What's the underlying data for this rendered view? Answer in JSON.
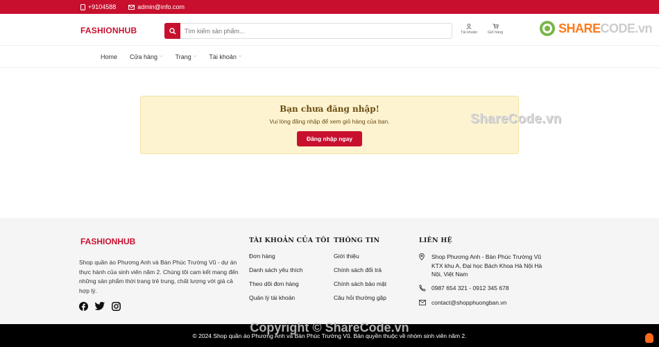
{
  "topbar": {
    "phone": "+9104588",
    "email": "admin@info.com"
  },
  "header": {
    "logo": "FASHIONHUB",
    "search_placeholder": "Tìm kiếm sản phẩm...",
    "account_label": "Tài khoản",
    "cart_label": "Giỏ hàng"
  },
  "watermark_logo": {
    "text_a": "SHARE",
    "text_b": "CODE.vn"
  },
  "nav": [
    {
      "label": "Home",
      "has_dropdown": false
    },
    {
      "label": "Cửa hàng",
      "has_dropdown": true
    },
    {
      "label": "Trang",
      "has_dropdown": true
    },
    {
      "label": "Tài khoản",
      "has_dropdown": true
    }
  ],
  "alert": {
    "title": "Bạn chưa đăng nhập!",
    "message": "Vui lòng đăng nhập để xem giỏ hàng của bạn.",
    "button": "Đăng nhập ngay"
  },
  "watermark_mid": "ShareCode.vn",
  "footer": {
    "logo": "FASHIONHUB",
    "description": "Shop quần áo Phương Anh và Bàn Phúc Trường Vũ - dự án thực hành của sinh viên năm 2. Chúng tôi cam kết mang đến những sản phẩm thời trang trẻ trung, chất lượng với giá cả hợp lý.",
    "social_icons": [
      "facebook-icon",
      "twitter-icon",
      "instagram-icon"
    ],
    "col_account": {
      "title": "TÀI KHOẢN CỦA TÔI",
      "items": [
        "Đơn hàng",
        "Danh sách yêu thích",
        "Theo dõi đơn hàng",
        "Quản lý tài khoản"
      ]
    },
    "col_info": {
      "title": "THÔNG TIN",
      "items": [
        "Giới thiệu",
        "Chính sách đổi trả",
        "Chính sách bảo mật",
        "Câu hỏi thường gặp"
      ]
    },
    "col_contact": {
      "title": "LIÊN HỆ",
      "address": "Shop Phương Anh - Bàn Phúc Trường Vũ KTX khu A, Đại học Bách Khoa Hà Nội Hà Nội, Việt Nam",
      "phone": "0987 654 321 - 0912 345 678",
      "email": "contact@shopphuongban.vn"
    }
  },
  "copyright": "© 2024 Shop quần áo Phương Anh và Bàn Phúc Trường Vũ. Bản quyền thuộc về nhóm sinh viên năm 2.",
  "watermark_bottom": "Copyright © ShareCode.vn",
  "colors": {
    "brand": "#c8102e",
    "alert_bg": "#fdf3d0",
    "footer_bg": "#f5f5f5"
  }
}
